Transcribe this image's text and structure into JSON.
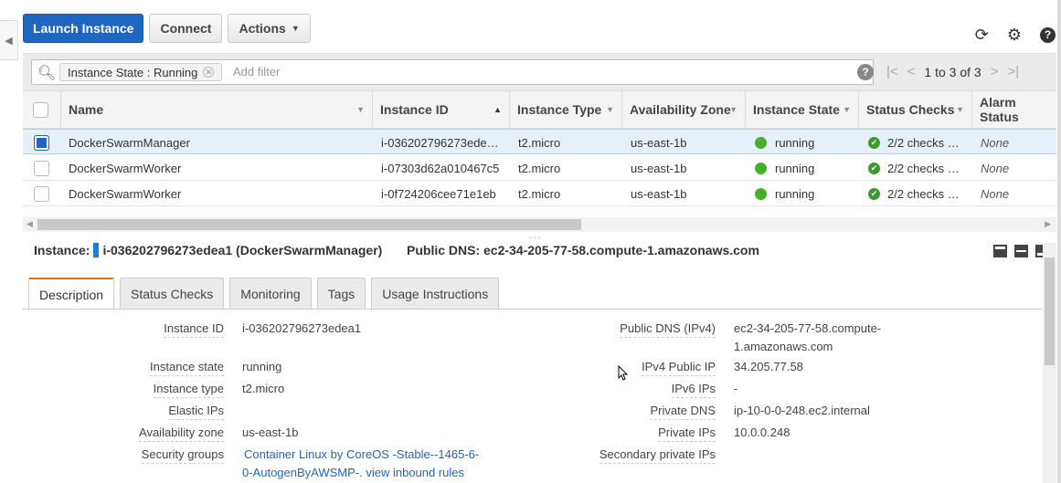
{
  "toolbar": {
    "launch_label": "Launch Instance",
    "connect_label": "Connect",
    "actions_label": "Actions"
  },
  "icons": {
    "refresh": "refresh-icon",
    "settings": "gear-icon",
    "help": "help-icon"
  },
  "filter": {
    "chip_key": "Instance State",
    "chip_sep": " : ",
    "chip_value": "Running",
    "placeholder": "Add filter"
  },
  "pager": {
    "text": "1 to 3 of 3"
  },
  "columns": [
    "Name",
    "Instance ID",
    "Instance Type",
    "Availability Zone",
    "Instance State",
    "Status Checks",
    "Alarm Status"
  ],
  "rows": [
    {
      "name": "DockerSwarmManager",
      "id": "i-036202796273ede…",
      "type": "t2.micro",
      "zone": "us-east-1b",
      "state": "running",
      "checks": "2/2 checks …",
      "alarm": "None",
      "selected": true
    },
    {
      "name": "DockerSwarmWorker",
      "id": "i-07303d62a010467c5",
      "type": "t2.micro",
      "zone": "us-east-1b",
      "state": "running",
      "checks": "2/2 checks …",
      "alarm": "None",
      "selected": false
    },
    {
      "name": "DockerSwarmWorker",
      "id": "i-0f724206cee71e1eb",
      "type": "t2.micro",
      "zone": "us-east-1b",
      "state": "running",
      "checks": "2/2 checks …",
      "alarm": "None",
      "selected": false
    }
  ],
  "detail": {
    "instance_label": "Instance:",
    "instance_value": "i-036202796273edea1 (DockerSwarmManager)",
    "dns_label": "Public DNS:",
    "dns_value": "ec2-34-205-77-58.compute-1.amazonaws.com",
    "tabs": [
      "Description",
      "Status Checks",
      "Monitoring",
      "Tags",
      "Usage Instructions"
    ],
    "left": [
      {
        "label": "Instance ID",
        "value": "i-036202796273edea1"
      },
      {
        "label": "Instance state",
        "value": "running"
      },
      {
        "label": "Instance type",
        "value": "t2.micro"
      },
      {
        "label": "Elastic IPs",
        "value": ""
      },
      {
        "label": "Availability zone",
        "value": "us-east-1b"
      },
      {
        "label": "Security groups",
        "value": "Container Linux by CoreOS -Stable--1465-6-",
        "value2": "0-AutogenByAWSMP-.",
        "link2": "view inbound rules"
      }
    ],
    "right": [
      {
        "label": "Public DNS (IPv4)",
        "value": "ec2-34-205-77-58.compute-",
        "value2": "1.amazonaws.com"
      },
      {
        "label": "IPv4 Public IP",
        "value": "34.205.77.58"
      },
      {
        "label": "IPv6 IPs",
        "value": "-"
      },
      {
        "label": "Private DNS",
        "value": "ip-10-0-0-248.ec2.internal"
      },
      {
        "label": "Private IPs",
        "value": "10.0.0.248"
      },
      {
        "label": "Secondary private IPs",
        "value": ""
      }
    ]
  }
}
